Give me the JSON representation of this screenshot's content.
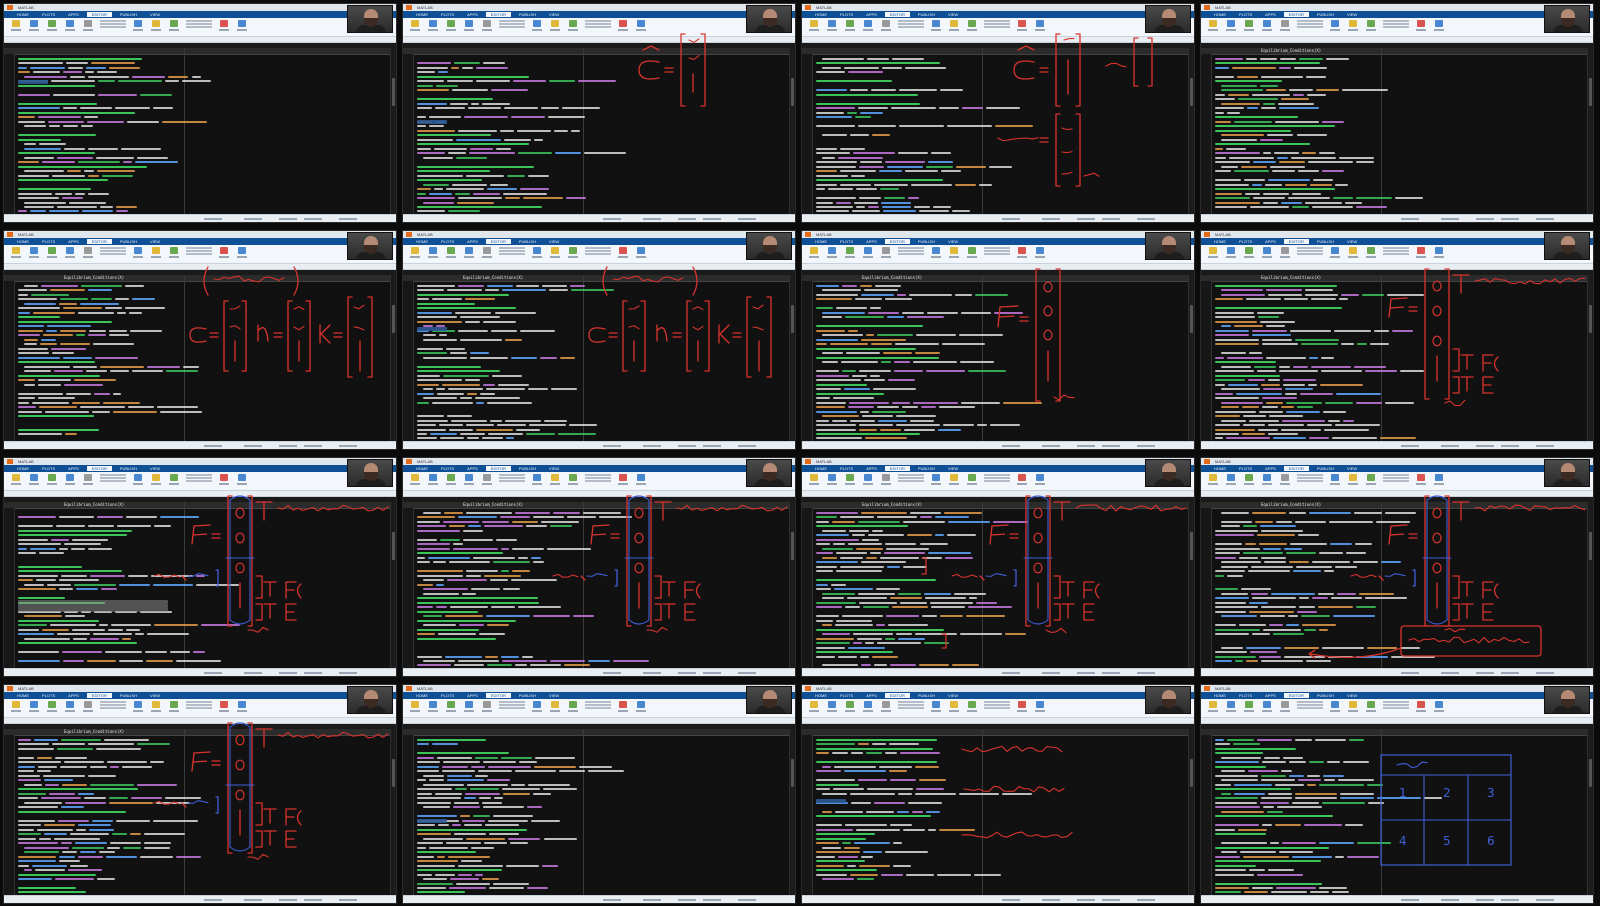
{
  "app": {
    "name": "MATLAB",
    "ribbon_tabs": [
      "HOME",
      "PLOTS",
      "APPS",
      "EDITOR",
      "PUBLISH",
      "VIEW"
    ],
    "selected_tab": "EDITOR",
    "webcam_caption": "",
    "editor_file_tab": "Equilibrium_Conditions(X)",
    "status_right": ""
  },
  "colors": {
    "ribbon_blue": "#0f4f95",
    "editor_bg": "#111111",
    "comment_green": "#3cc45a",
    "code_white": "#dcdcdc",
    "string_purple": "#c678dd",
    "number_orange": "#e39b4a",
    "keyword_blue": "#5ea7ff",
    "ink_red": "#d8342e",
    "ink_blue": "#3f5fd8",
    "selection": "#2f5a96"
  },
  "tiles": [
    {
      "id": 1,
      "ink": "none"
    },
    {
      "id": 2,
      "ink": "C-vector"
    },
    {
      "id": 3,
      "ink": "C-vector-guess"
    },
    {
      "id": 4,
      "ink": "none"
    },
    {
      "id": 5,
      "ink": "C-n-k-vectors"
    },
    {
      "id": 6,
      "ink": "C-n-k-vectors"
    },
    {
      "id": 7,
      "ink": "F-vector"
    },
    {
      "id": 8,
      "ink": "F-vector-labels"
    },
    {
      "id": 9,
      "ink": "F-vector-braces"
    },
    {
      "id": 10,
      "ink": "F-vector-braces"
    },
    {
      "id": 11,
      "ink": "F-vector-braces-more"
    },
    {
      "id": 12,
      "ink": "F-vector-terminal"
    },
    {
      "id": 13,
      "ink": "F-vector-braces"
    },
    {
      "id": 14,
      "ink": "none"
    },
    {
      "id": 15,
      "ink": "production-equations"
    },
    {
      "id": 16,
      "ink": "subplot-grid"
    }
  ]
}
